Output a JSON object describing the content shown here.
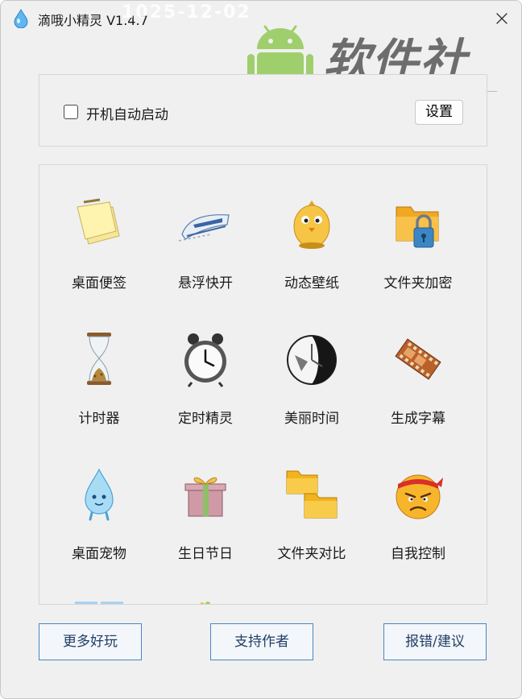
{
  "window": {
    "title": "滴哦小精灵 V1.4.7",
    "title_watermark": "1025-12-02"
  },
  "brand": {
    "name": "软件社",
    "url": "rjshe.com"
  },
  "settings": {
    "autostart_label": "开机自动启动",
    "autostart_checked": false,
    "settings_button": "设置"
  },
  "tools": [
    {
      "label": "桌面便签",
      "icon": "sticky-note-icon"
    },
    {
      "label": "悬浮快开",
      "icon": "bullet-train-icon"
    },
    {
      "label": "动态壁纸",
      "icon": "chick-icon"
    },
    {
      "label": "文件夹加密",
      "icon": "locked-folder-icon"
    },
    {
      "label": "计时器",
      "icon": "hourglass-icon"
    },
    {
      "label": "定时精灵",
      "icon": "alarm-clock-icon"
    },
    {
      "label": "美丽时间",
      "icon": "clock-face-icon"
    },
    {
      "label": "生成字幕",
      "icon": "film-strip-icon"
    },
    {
      "label": "桌面宠物",
      "icon": "water-drop-pet-icon"
    },
    {
      "label": "生日节日",
      "icon": "gift-box-icon"
    },
    {
      "label": "文件夹对比",
      "icon": "folders-compare-icon"
    },
    {
      "label": "自我控制",
      "icon": "angry-face-icon"
    }
  ],
  "footer": {
    "more_fun": "更多好玩",
    "support_author": "支持作者",
    "report_suggest": "报错/建议"
  },
  "colors": {
    "window_bg": "#f0f0f0",
    "button_border": "#4a86c5",
    "folder_yellow": "#f3b31b"
  }
}
